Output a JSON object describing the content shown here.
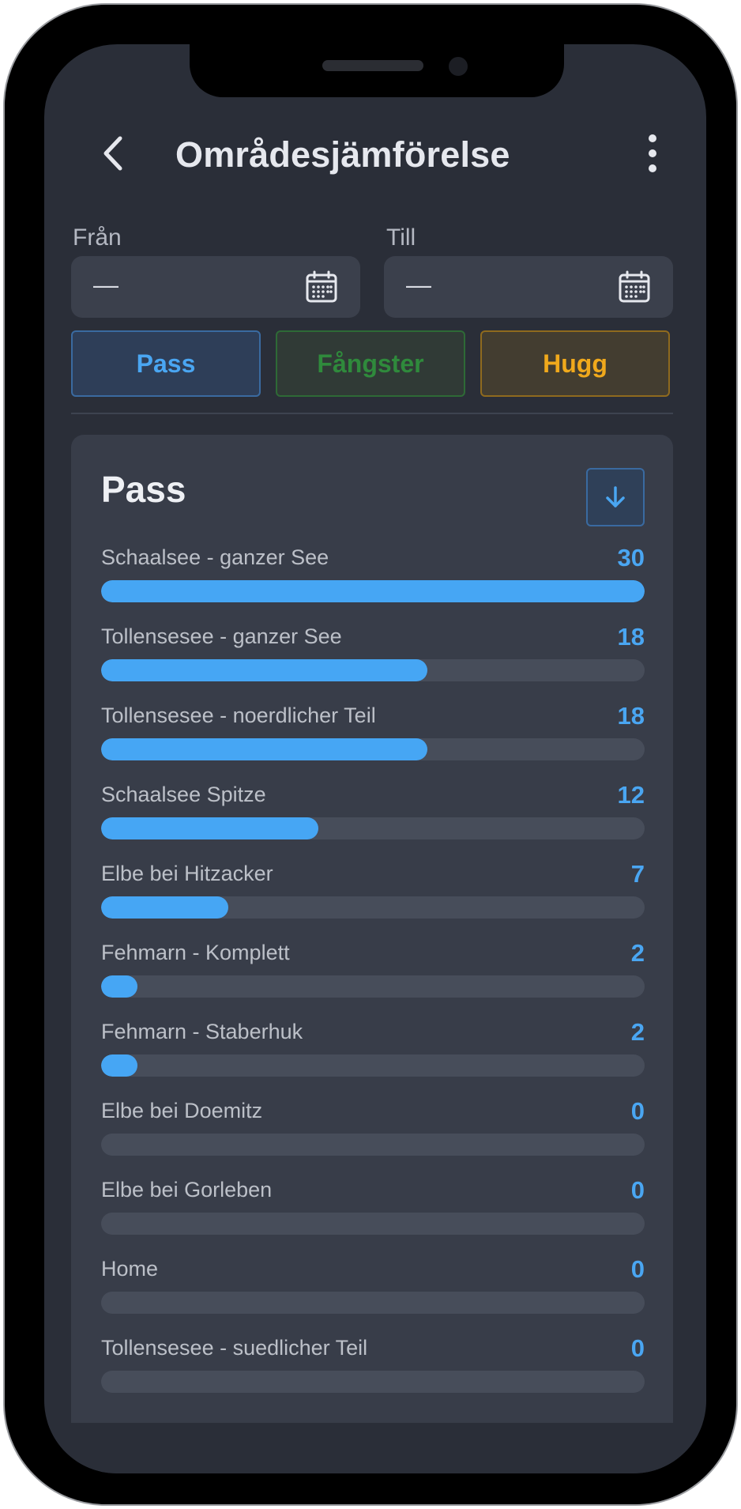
{
  "header": {
    "title": "Områdesjämförelse"
  },
  "date_range": {
    "from_label": "Från",
    "from_value": "—",
    "to_label": "Till",
    "to_value": "—"
  },
  "tabs": [
    {
      "label": "Pass",
      "active": true,
      "color": "#4aa6f2"
    },
    {
      "label": "Fångster",
      "active": false,
      "color": "#2f8a3c"
    },
    {
      "label": "Hugg",
      "active": false,
      "color": "#f0a91c"
    }
  ],
  "card": {
    "title": "Pass",
    "max_value": 30,
    "rows": [
      {
        "label": "Schaalsee - ganzer See",
        "value": 30
      },
      {
        "label": "Tollensesee - ganzer See",
        "value": 18
      },
      {
        "label": "Tollensesee - noerdlicher Teil",
        "value": 18
      },
      {
        "label": "Schaalsee Spitze",
        "value": 12
      },
      {
        "label": "Elbe bei Hitzacker",
        "value": 7
      },
      {
        "label": "Fehmarn - Komplett",
        "value": 2
      },
      {
        "label": "Fehmarn - Staberhuk",
        "value": 2
      },
      {
        "label": "Elbe bei Doemitz",
        "value": 0
      },
      {
        "label": "Elbe bei Gorleben",
        "value": 0
      },
      {
        "label": "Home",
        "value": 0
      },
      {
        "label": "Tollensesee - suedlicher Teil",
        "value": 0
      }
    ]
  },
  "icons": {
    "back": "chevron-left-icon",
    "menu": "more-vertical-icon",
    "calendar": "calendar-icon",
    "sort": "arrow-down-icon"
  }
}
